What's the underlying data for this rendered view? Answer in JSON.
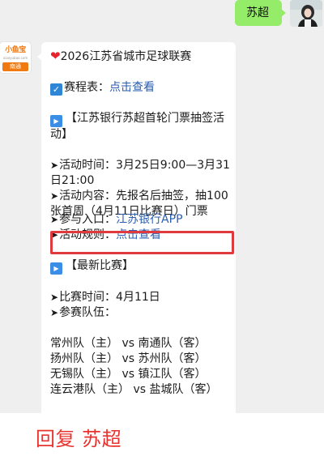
{
  "outgoing": {
    "text": "苏超"
  },
  "incoming": {
    "logo": {
      "title": "小鱼宝",
      "url": "xiaoyubao.com",
      "city": "南通"
    },
    "lines": {
      "title": "2026江苏省城市足球联赛",
      "schedule_label": "赛程表：",
      "schedule_link": "点击查看",
      "section1_heading": "【江苏银行苏超首轮门票抽签活动】",
      "activity_time": "活动时间：3月25日9:00—3月31日21:00",
      "activity_content": "活动内容：先报名后抽签，抽100张首周（4月11日比赛日）门票",
      "entry_label": "参与入口：",
      "entry_link": "江苏银行APP",
      "rules_label": "活动规则：",
      "rules_link": "点击查看",
      "section2_heading": "【最新比赛】",
      "match_time": "比赛时间：4月11日",
      "teams_label": "参赛队伍：",
      "matches": [
        "常州队（主） vs 南通队（客）",
        "扬州队（主） vs 苏州队（客）",
        "无锡队（主） vs 镇江队（客）",
        "连云港队（主） vs 盐城队（客）"
      ]
    }
  },
  "reply_hint": "回复 苏超",
  "colors": {
    "outgoing_bubble": "#95ec69",
    "link": "#2a5db0",
    "highlight": "#e0393e",
    "reply_text": "#e8332f",
    "logo_orange": "#f07a12"
  },
  "icons": {
    "heart": "heart-icon",
    "check": "check-box-icon",
    "play": "play-button-icon",
    "arrow": "arrow-right-icon"
  }
}
